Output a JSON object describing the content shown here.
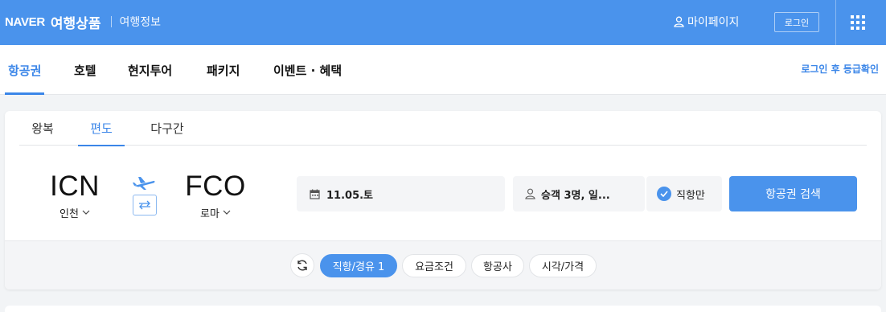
{
  "header": {
    "brand": "NAVER",
    "product": "여행상품",
    "info": "여행정보",
    "mypage": "마이페이지",
    "login": "로그인",
    "icons": {
      "user": "user-icon",
      "apps": "app-grid-icon"
    },
    "color": "#4a93ec"
  },
  "categories": [
    "항공권",
    "호텔",
    "현지투어",
    "패키지",
    "이벤트 · 혜택"
  ],
  "active_category": "항공권",
  "grade_link": "로그인 후 등급확인",
  "trip_tabs": [
    "왕복",
    "편도",
    "다구간"
  ],
  "active_trip_tab": "편도",
  "origin": {
    "code": "ICN",
    "city": "인천"
  },
  "destination": {
    "code": "FCO",
    "city": "로마"
  },
  "date": "11.05.토",
  "passengers": "승객 3명, 일...",
  "direct_only": "직항만",
  "search_button": "항공권 검색",
  "filters": [
    "직항/경유 1",
    "요금조건",
    "항공사",
    "시각/가격"
  ],
  "active_filter": "직항/경유 1",
  "accent_color": "#3b86e8"
}
